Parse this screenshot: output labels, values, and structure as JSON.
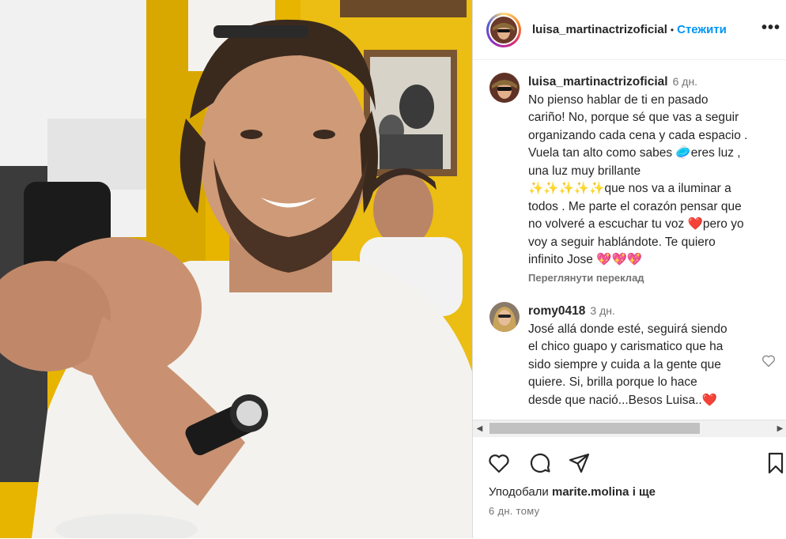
{
  "header": {
    "username": "luisa_martinactrizoficial",
    "separator": "•",
    "follow_label": "Стежити",
    "more_label": "•••"
  },
  "comments": [
    {
      "username": "luisa_martinactrizoficial",
      "time": "6 дн.",
      "lines": [
        "No pienso hablar de ti en pasado",
        "cariño! No, porque sé que vas a seguir",
        "organizando cada cena y cada espacio .",
        "Vuela tan alto como sabes 🥏eres luz ,",
        "una luz muy brillante",
        "✨✨✨✨✨que nos va a iluminar a",
        "todos . Me parte el corazón pensar que",
        "no volveré a escuchar tu voz ❤️pero yo",
        "voy a seguir hablándote. Te quiero",
        "infinito Jose 💖💖💖"
      ],
      "translate_label": "Переглянути переклад"
    },
    {
      "username": "romy0418",
      "time": "3 дн.",
      "lines": [
        "José allá donde esté, seguirá siendo",
        "el chico guapo y carismatico que ha",
        "sido siempre y cuida a la gente que",
        "quiere. Si, brilla porque lo hace",
        "desde que nació...Besos Luisa..❤️"
      ]
    }
  ],
  "scrollbar": {
    "left_arrow": "◀",
    "right_arrow": "▶"
  },
  "actions": {
    "icons": [
      "heart-icon",
      "comment-icon",
      "share-icon",
      "bookmark-icon"
    ],
    "likes_prefix": "Уподобали",
    "likes_user": "marite.molina",
    "likes_suffix": "і ще",
    "posted_ago": "6 дн. тому"
  },
  "colors": {
    "follow": "#0095f6",
    "text": "#262626",
    "muted": "#737373",
    "wall_yellow": "#e9b800"
  }
}
